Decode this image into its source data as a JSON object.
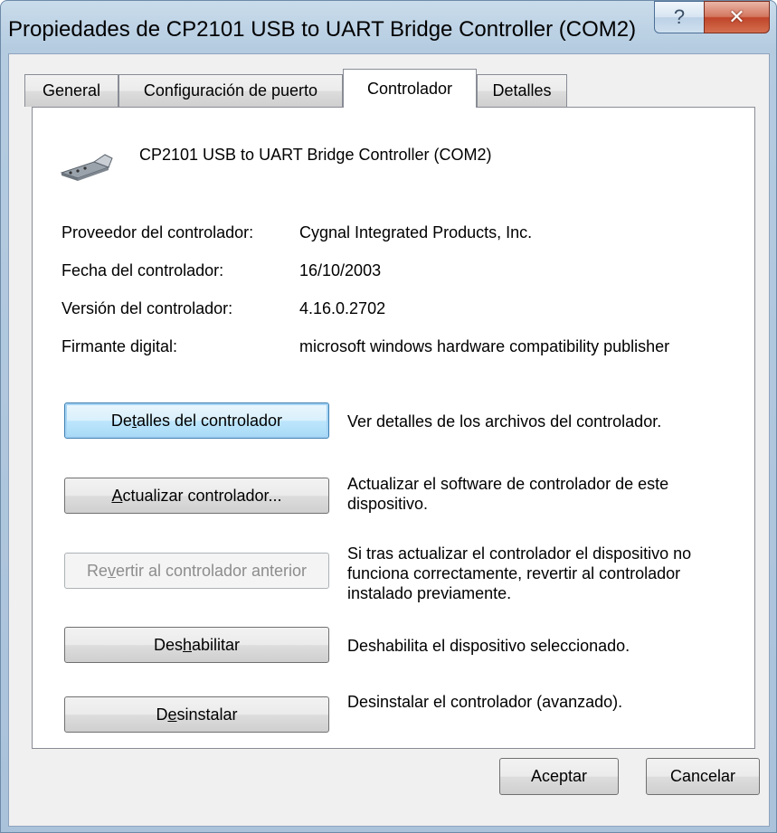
{
  "window": {
    "title": "Propiedades de CP2101 USB to UART Bridge Controller (COM2)",
    "help_glyph": "?",
    "close_glyph": "✕"
  },
  "tabs": [
    {
      "label": "General",
      "active": false
    },
    {
      "label": "Configuración de puerto",
      "active": false
    },
    {
      "label": "Controlador",
      "active": true
    },
    {
      "label": "Detalles",
      "active": false
    }
  ],
  "device": {
    "name": "CP2101 USB to UART Bridge Controller (COM2)",
    "icon": "serial-port-icon"
  },
  "info": [
    {
      "label": "Proveedor del controlador:",
      "value": "Cygnal Integrated Products, Inc."
    },
    {
      "label": "Fecha del controlador:",
      "value": "16/10/2003"
    },
    {
      "label": "Versión del controlador:",
      "value": "4.16.0.2702"
    },
    {
      "label": "Firmante digital:",
      "value": "microsoft windows hardware compatibility publisher"
    }
  ],
  "actions": [
    {
      "pre": "De",
      "u": "t",
      "post": "alles del controlador",
      "desc": "Ver detalles de los archivos del controlador."
    },
    {
      "pre": "",
      "u": "A",
      "post": "ctualizar controlador...",
      "desc": "Actualizar el software de controlador de este dispositivo."
    },
    {
      "pre": "Re",
      "u": "v",
      "post": "ertir al controlador anterior",
      "desc": "Si tras actualizar el controlador el dispositivo no funciona correctamente, revertir al controlador instalado previamente."
    },
    {
      "pre": "Des",
      "u": "h",
      "post": "abilitar",
      "desc": "Deshabilita el dispositivo seleccionado."
    },
    {
      "pre": "D",
      "u": "e",
      "post": "sinstalar",
      "desc": "Desinstalar el controlador (avanzado)."
    }
  ],
  "footer": {
    "ok": "Aceptar",
    "cancel": "Cancelar"
  }
}
